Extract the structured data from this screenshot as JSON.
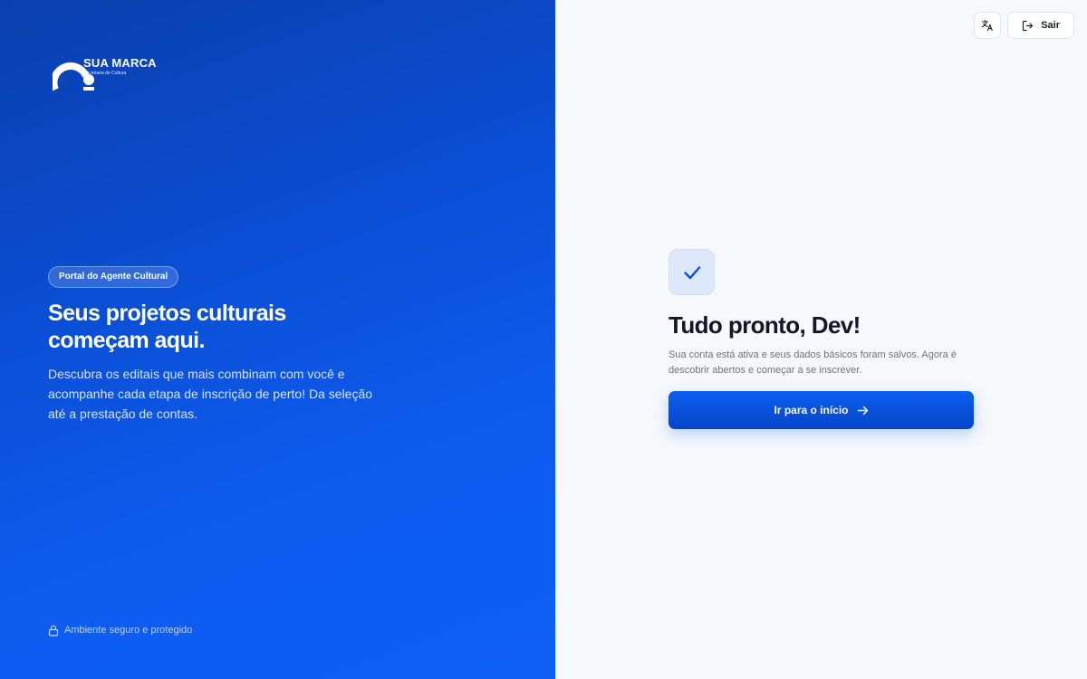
{
  "brand": {
    "title": "SUA MARCA",
    "subtitle": "Secretaria de Cultura"
  },
  "hero": {
    "badge": "Portal do Agente Cultural",
    "title": "Seus projetos culturais começam aqui.",
    "description": "Descubra os editais que mais combinam com você e acompanhe cada etapa de inscrição de perto! Da seleção até a prestação de contas."
  },
  "footer": {
    "secure_text": "Ambiente seguro e protegido"
  },
  "header": {
    "language_icon": "translate-icon",
    "logout_label": "Sair"
  },
  "completion": {
    "title": "Tudo pronto, Dev!",
    "description": "Sua conta está ativa e seus dados básicos foram salvos. Agora é descobrir abertos e começar a se inscrever.",
    "cta_label": "Ir para o início"
  },
  "colors": {
    "brand_blue": "#0d5ef0",
    "text_dark": "#111827"
  }
}
